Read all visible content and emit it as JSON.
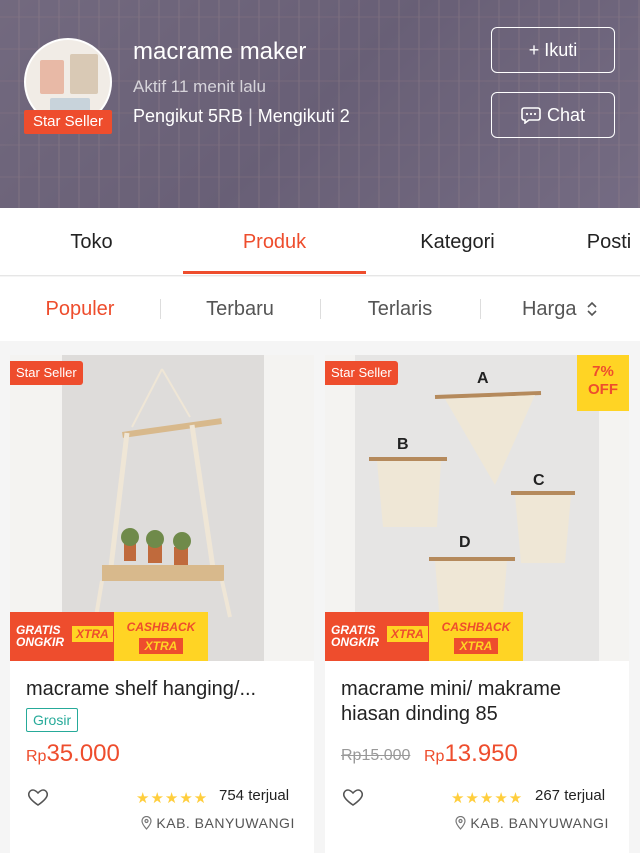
{
  "shop": {
    "name": "macrame maker",
    "active": "Aktif 11 menit lalu",
    "followers_label": "Pengikut 5RB",
    "following_label": "Mengikuti 2",
    "badge": "Star Seller",
    "follow_button": "+ Ikuti",
    "chat_button": "Chat"
  },
  "tabs": [
    {
      "label": "Toko"
    },
    {
      "label": "Produk"
    },
    {
      "label": "Kategori"
    },
    {
      "label": "Posti"
    }
  ],
  "sort": [
    {
      "label": "Populer"
    },
    {
      "label": "Terbaru"
    },
    {
      "label": "Terlaris"
    },
    {
      "label": "Harga"
    }
  ],
  "products": [
    {
      "badge": "Star Seller",
      "title": "macrame shelf hanging/...",
      "tag": "Grosir",
      "price_prefix": "Rp",
      "price": "35.000",
      "rating_stars": 4.5,
      "sold": "754 terjual",
      "location": "KAB. BANYUWANGI",
      "promo_left_1": "GRATIS",
      "promo_left_2": "ONGKIR",
      "promo_left_xtra": "XTRA",
      "promo_right_1": "CASHBACK",
      "promo_right_xtra": "XTRA"
    },
    {
      "badge": "Star Seller",
      "discount_1": "7%",
      "discount_2": "OFF",
      "title": "macrame mini/ makrame hiasan dinding 85",
      "old_price": "Rp15.000",
      "price_prefix": "Rp",
      "price": "13.950",
      "rating_stars": 4.5,
      "sold": "267 terjual",
      "location": "KAB. BANYUWANGI",
      "promo_left_1": "GRATIS",
      "promo_left_2": "ONGKIR",
      "promo_left_xtra": "XTRA",
      "promo_right_1": "CASHBACK",
      "promo_right_xtra": "XTRA",
      "image_letters": [
        "A",
        "B",
        "C",
        "D"
      ]
    }
  ],
  "colors": {
    "accent": "#ee4d2d",
    "promo_yellow": "#ffd424",
    "grosir": "#26aa99",
    "star": "#ffce3d"
  }
}
